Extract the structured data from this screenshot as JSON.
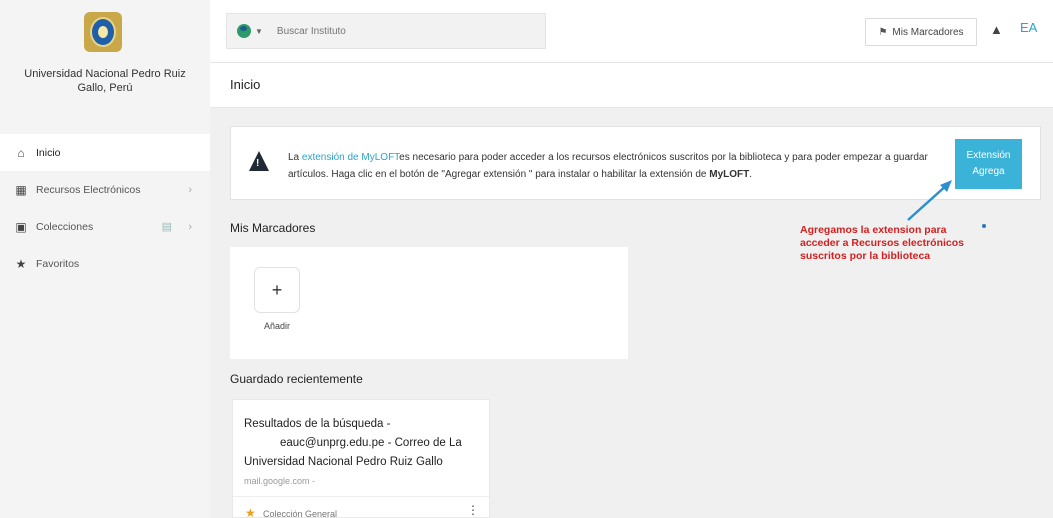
{
  "sidebar": {
    "university": "Universidad Nacional Pedro Ruiz Gallo, Perú",
    "items": [
      {
        "label": "Inicio",
        "icon": "home-icon"
      },
      {
        "label": "Recursos Electrónicos",
        "icon": "books-icon"
      },
      {
        "label": "Colecciones",
        "icon": "briefcase-icon"
      },
      {
        "label": "Favoritos",
        "icon": "star-icon"
      }
    ]
  },
  "topbar": {
    "search_placeholder": "Buscar Instituto",
    "bookmarks_label": "Mis Marcadores",
    "avatar_initials": "EA"
  },
  "page": {
    "title": "Inicio"
  },
  "banner": {
    "text_prefix": "La ",
    "link_text": "extensión de MyLOFT",
    "text_middle": "es necesario para poder acceder a los recursos electrónicos suscritos por la biblioteca y para poder empezar a guardar artículos. Haga clic en el botón de \"Agregar extensión \" para instalar o habilitar la extensión de ",
    "text_bold": "MyLOFT",
    "text_suffix": ".",
    "button_line1": "Extensión",
    "button_line2": "Agrega"
  },
  "annotation": {
    "text": "Agregamos la extension para acceder a Recursos electrónicos suscritos por la biblioteca"
  },
  "bookmarks_section": {
    "title": "Mis Marcadores",
    "add_label": "Añadir"
  },
  "recent_section": {
    "title": "Guardado recientemente",
    "item_title_line1": "Resultados de la búsqueda -",
    "item_title_line2": "eauc@unprg.edu.pe - Correo de La Universidad Nacional Pedro Ruiz Gallo",
    "item_url": "mail.google.com -",
    "item_collection": "Colección General"
  }
}
